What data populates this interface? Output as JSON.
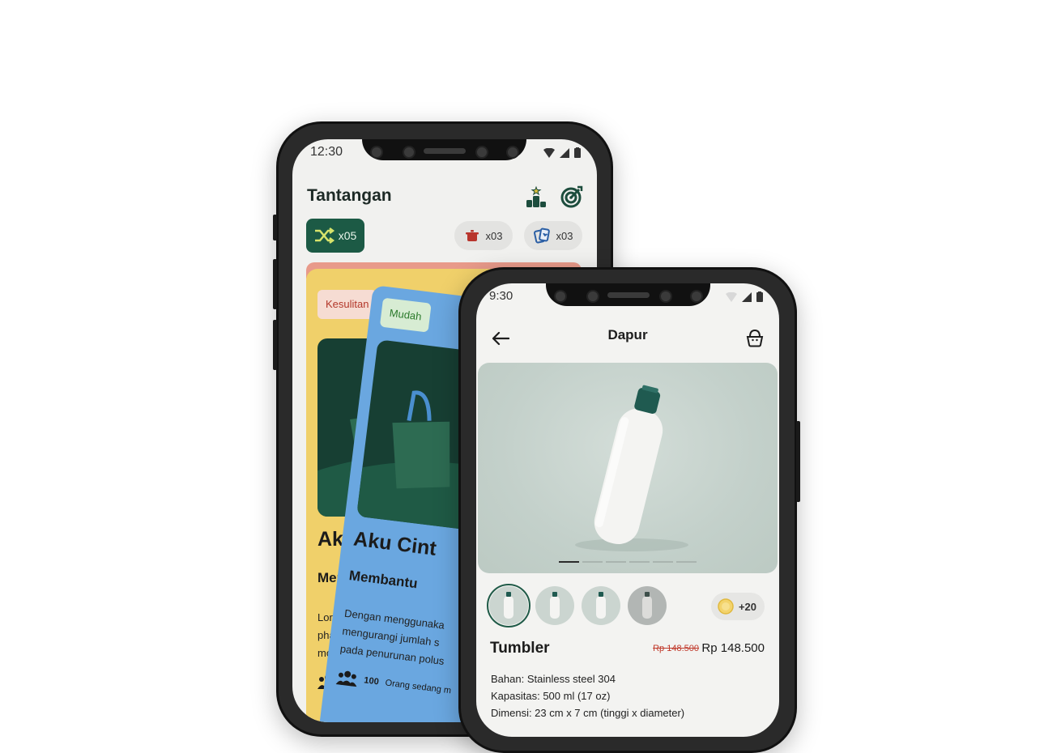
{
  "left_phone": {
    "status_time": "12:30",
    "title": "Tantangan",
    "shuffle_count": "x05",
    "pill_1_count": "x03",
    "pill_2_count": "x03",
    "card_back": {
      "badge": "Kesulitan",
      "title": "Aku S",
      "subtitle": "Memba",
      "body": [
        "Lorem ip",
        "pharetr",
        "mollis"
      ],
      "colors": {
        "card": "#f0d06a",
        "badge_bg": "#f6dcd3",
        "badge_text": "#b3372a"
      }
    },
    "card_front": {
      "badge": "Mudah",
      "title": "Aku Cint",
      "subtitle": "Membantu",
      "body": [
        "Dengan menggunaka",
        "mengurangi jumlah s",
        "pada penurunan polus"
      ],
      "participants": "100",
      "participants_label": "Orang sedang m",
      "colors": {
        "card": "#6aa7e0",
        "badge_bg": "#d7ecd3",
        "badge_text": "#2b7a2b"
      }
    }
  },
  "right_phone": {
    "status_time": "9:30",
    "title": "Dapur",
    "image_count": 6,
    "active_image_index": 0,
    "coins": "+20",
    "product_name": "Tumbler",
    "price_old": "Rp 148.500",
    "price_new": "Rp 148.500",
    "specs": [
      "Bahan: Stainless steel 304",
      "Kapasitas: 500 ml (17 oz)",
      "Dimensi: 23 cm x 7 cm (tinggi x diameter)"
    ]
  },
  "icons": [
    "leaderboard-icon",
    "target-icon",
    "shuffle-icon",
    "pot-icon",
    "cards-icon",
    "back-arrow-icon",
    "basket-icon",
    "coin-icon",
    "people-icon"
  ],
  "accent": "#1c5a45"
}
